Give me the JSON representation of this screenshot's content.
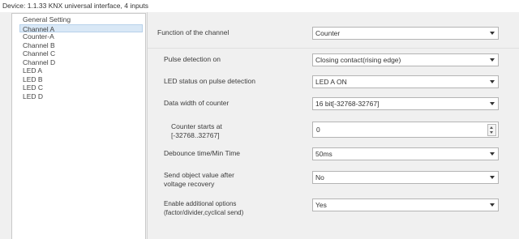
{
  "window": {
    "title": "Device: 1.1.33  KNX universal interface, 4 inputs"
  },
  "nav": {
    "items": [
      {
        "label": "General Setting"
      },
      {
        "label": "Channel A"
      },
      {
        "label": "Counter-A"
      },
      {
        "label": "Channel B"
      },
      {
        "label": "Channel C"
      },
      {
        "label": "Channel D"
      },
      {
        "label": "LED A"
      },
      {
        "label": "LED B"
      },
      {
        "label": "LED C"
      },
      {
        "label": "LED D"
      }
    ],
    "selected_index": 1
  },
  "params": {
    "function": {
      "label": "Function of the channel",
      "value": "Counter"
    },
    "pulse": {
      "label": "Pulse detection on",
      "value": "Closing contact(rising edge)"
    },
    "led_status": {
      "label": "LED status on pulse detection",
      "value": "LED A ON"
    },
    "data_width": {
      "label": "Data width of counter",
      "value": "16 bit[-32768-32767]"
    },
    "counter_start": {
      "label_line1": "Counter starts at",
      "label_line2": "[-32768..32767]",
      "value": "0"
    },
    "debounce": {
      "label": "Debounce time/Min Time",
      "value": "50ms"
    },
    "send_after_recovery": {
      "label_line1": "Send object value after",
      "label_line2": "voltage recovery",
      "value": "No"
    },
    "additional": {
      "label_line1": "Enable additional options",
      "label_line2": "(factor/divider,cyclical send)",
      "value": "Yes"
    }
  },
  "icons": {
    "dropdown": "chevron-down-icon",
    "spin_up": "spin-up-icon",
    "spin_down": "spin-down-icon"
  }
}
